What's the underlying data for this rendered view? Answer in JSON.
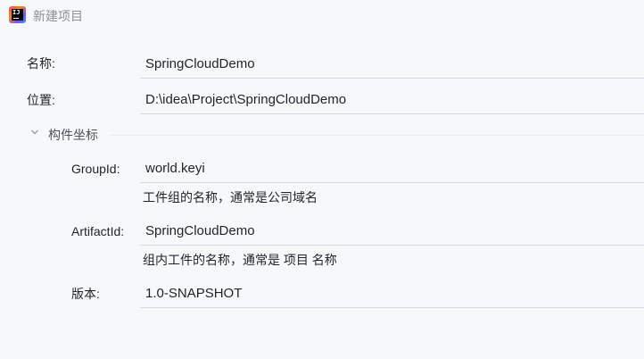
{
  "window": {
    "title": "新建项目",
    "logo_icon": "intellij-idea-icon"
  },
  "form": {
    "name": {
      "label": "名称:",
      "value": "SpringCloudDemo"
    },
    "location": {
      "label": "位置:",
      "value": "D:\\idea\\Project\\SpringCloudDemo"
    }
  },
  "artifact_section": {
    "title": "构件坐标",
    "expanded": true,
    "toggle_icon": "chevron-down-icon",
    "group_id": {
      "label": "GroupId:",
      "value": "world.keyi",
      "hint": "工件组的名称，通常是公司域名"
    },
    "artifact_id": {
      "label": "ArtifactId:",
      "value": "SpringCloudDemo",
      "hint": "组内工件的名称，通常是 项目 名称"
    },
    "version": {
      "label": "版本:",
      "value": "1.0-SNAPSHOT"
    }
  },
  "colors": {
    "background": "#f7f8fa",
    "field_underline": "#cfdcec",
    "muted_text": "#8c8f94"
  }
}
